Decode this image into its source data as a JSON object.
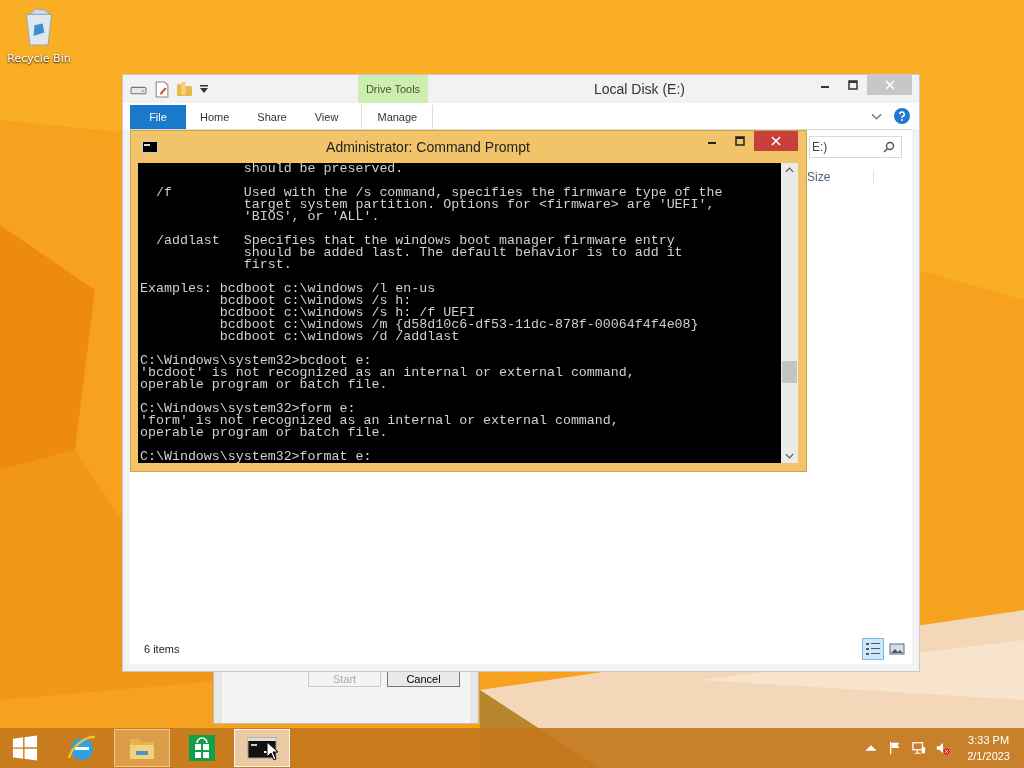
{
  "desktop_icons": [
    {
      "label": "Recycle Bin"
    }
  ],
  "format_dialog": {
    "buttons": [
      {
        "label": "Start",
        "disabled": true
      },
      {
        "label": "Cancel",
        "disabled": false
      }
    ]
  },
  "explorer": {
    "title": "Local Disk (E:)",
    "contextual_tab": "Drive Tools",
    "ribbon_tabs": [
      {
        "label": "File",
        "kind": "file"
      },
      {
        "label": "Home",
        "kind": "tab"
      },
      {
        "label": "Share",
        "kind": "tab"
      },
      {
        "label": "View",
        "kind": "tab"
      },
      {
        "label": "Manage",
        "kind": "contextual"
      }
    ],
    "search_value": "E:)",
    "column_header": "Size",
    "status": "6 items",
    "view_buttons": [
      {
        "kind": "details",
        "selected": true
      },
      {
        "kind": "large-icons",
        "selected": false
      }
    ]
  },
  "console_window": {
    "title": "Administrator: Command Prompt",
    "blocks": [
      [
        "             should be preserved."
      ],
      [
        "  /f         Used with the /s command, specifies the firmware type of the",
        "             target system partition. Options for <firmware> are 'UEFI',",
        "             'BIOS', or 'ALL'."
      ],
      [
        "  /addlast   Specifies that the windows boot manager firmware entry",
        "             should be added last. The default behavior is to add it",
        "             first."
      ],
      [
        "Examples: bcdboot c:\\windows /l en-us",
        "          bcdboot c:\\windows /s h:",
        "          bcdboot c:\\windows /s h: /f UEFI",
        "          bcdboot c:\\windows /m {d58d10c6-df53-11dc-878f-00064f4f4e08}",
        "          bcdboot c:\\windows /d /addlast"
      ],
      [
        "C:\\Windows\\system32>bcdoot e:",
        "'bcdoot' is not recognized as an internal or external command,",
        "operable program or batch file."
      ],
      [
        "C:\\Windows\\system32>form e:",
        "'form' is not recognized as an internal or external command,",
        "operable program or batch file."
      ],
      [
        "C:\\Windows\\system32>format e:"
      ]
    ]
  },
  "taskbar": {
    "apps": [
      {
        "kind": "ie",
        "running": false,
        "selected": false
      },
      {
        "kind": "explorer",
        "running": true,
        "selected": false
      },
      {
        "kind": "store",
        "running": false,
        "selected": false
      },
      {
        "kind": "cmd",
        "running": true,
        "selected": true
      }
    ],
    "time": "3:33 PM",
    "date": "2/1/2023"
  }
}
